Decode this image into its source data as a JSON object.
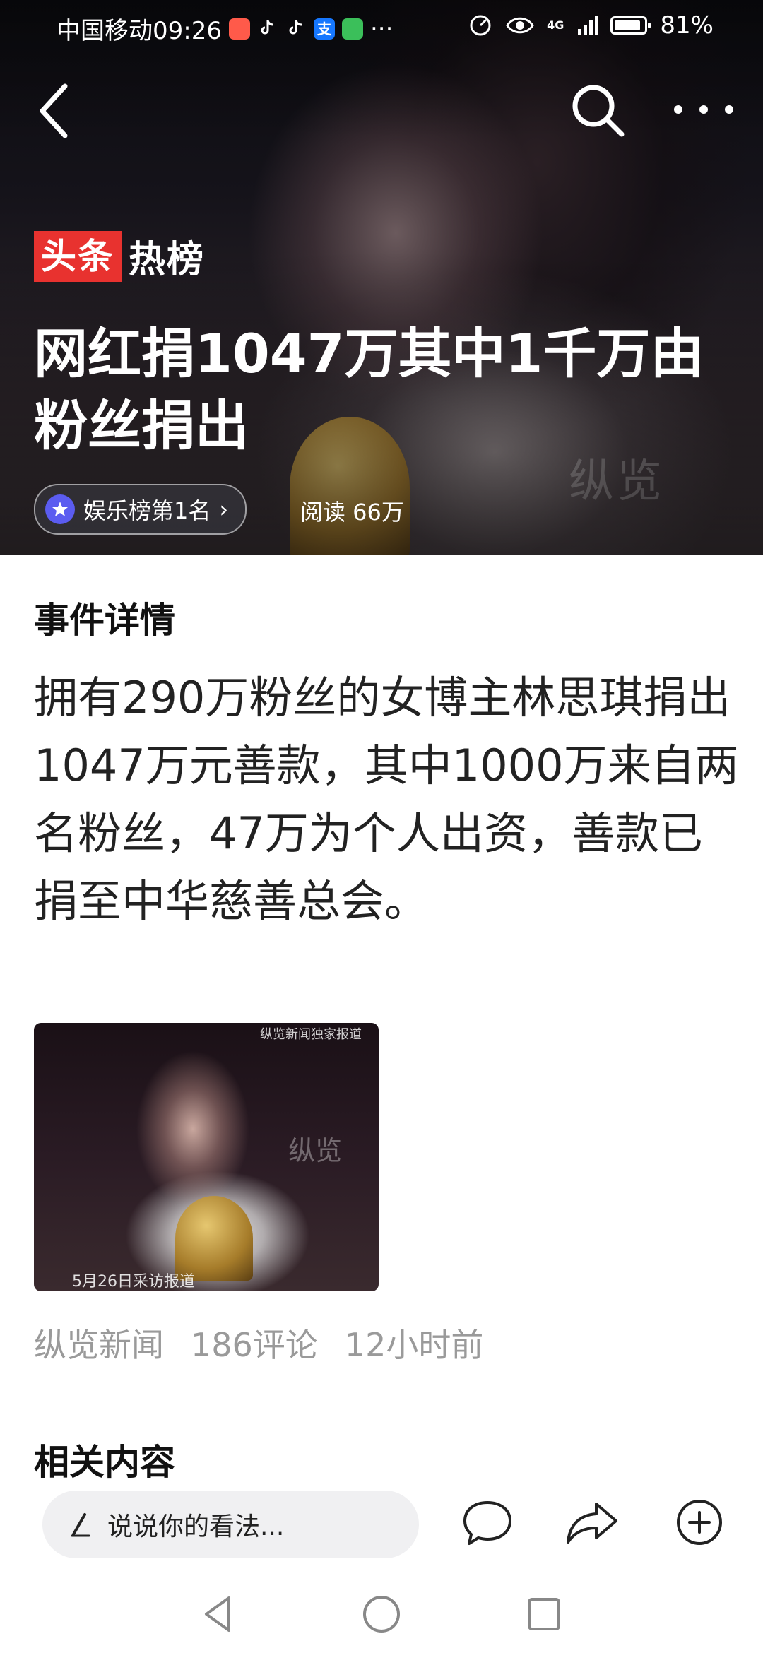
{
  "status_bar": {
    "carrier_time": "中国移动09:26",
    "icons": [
      "app-red-icon",
      "tiktok-icon",
      "tiktok-icon",
      "alipay-icon",
      "wechat-mini-icon",
      "more-dots"
    ],
    "alipay_glyph": "支",
    "more": "···",
    "network": "4G",
    "battery_percent": 81,
    "battery_text": "81%"
  },
  "nav": {
    "back_icon": "chevron-left-icon",
    "search_icon": "search-icon",
    "more_icon": "more-horizontal-icon"
  },
  "hero": {
    "logo_red": "头条",
    "logo_white": "热榜",
    "headline": "网红捐1047万其中1千万由粉丝捐出",
    "rank_chip": "娱乐榜第1名",
    "rank_chevron": "›",
    "read_count": "阅读 66万",
    "watermark": "纵览"
  },
  "event": {
    "title": "事件详情",
    "body": "拥有290万粉丝的女博主林思琪捐出1047万元善款，其中1000万来自两名粉丝，47万为个人出资，善款已捐至中华慈善总会。"
  },
  "news_image": {
    "top_caption": "纵览新闻独家报道",
    "bottom_caption": "5月26日采访报道",
    "watermark": "纵览"
  },
  "meta": {
    "source": "纵览新闻",
    "comments": "186评论",
    "time": "12小时前"
  },
  "related": {
    "title": "相关内容"
  },
  "action_bar": {
    "comment_placeholder": "说说你的看法...",
    "comment_icon": "chat-bubble-icon",
    "share_icon": "share-arrow-icon",
    "add_icon": "plus-circle-icon"
  },
  "system_nav": [
    "back-triangle-icon",
    "home-circle-icon",
    "recent-square-icon"
  ]
}
